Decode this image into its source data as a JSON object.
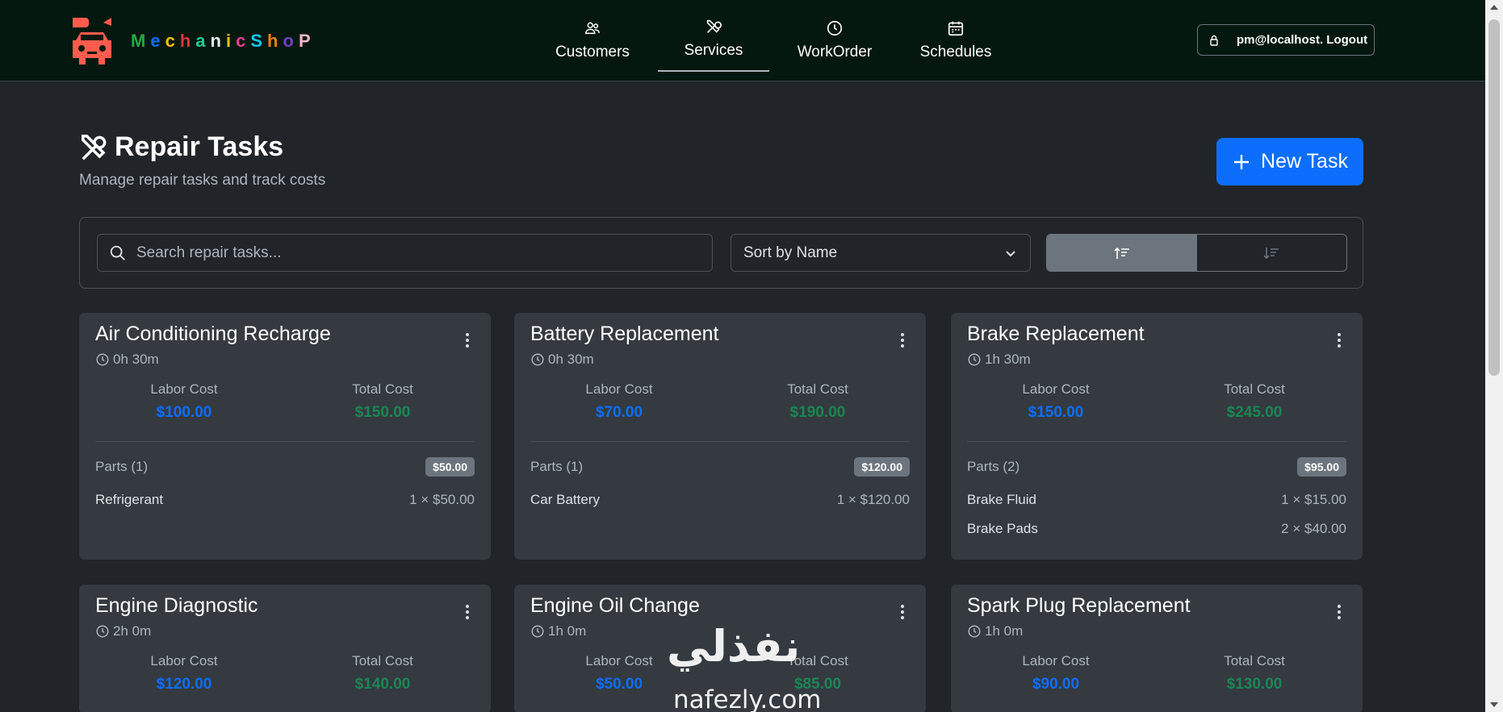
{
  "brand": {
    "letters": [
      "M",
      "e",
      "c",
      "h",
      "a",
      "n",
      "i",
      "c",
      "S",
      "h",
      "o",
      "P"
    ],
    "letter_colors": [
      "#28a745",
      "#0d6efd",
      "#ffc107",
      "#dc3545",
      "#20c997",
      "#e9ecef",
      "#ffc107",
      "#e83e8c",
      "#0dcaf0",
      "#fd7e14",
      "#6f42c1",
      "#f8b4c8"
    ],
    "logo_color": "#ff5c4d"
  },
  "nav": {
    "items": [
      {
        "label": "Customers",
        "icon": "people-icon"
      },
      {
        "label": "Services",
        "icon": "tools-icon",
        "active": true
      },
      {
        "label": "WorkOrder",
        "icon": "clock-icon"
      },
      {
        "label": "Schedules",
        "icon": "calendar-icon"
      }
    ],
    "logout_label": "pm@localhost. Logout"
  },
  "header": {
    "title": "Repair Tasks",
    "subtitle": "Manage repair tasks and track costs",
    "new_task_label": "New Task"
  },
  "filters": {
    "search_placeholder": "Search repair tasks...",
    "sort_selected": "Sort by Name",
    "order": "ascending"
  },
  "cards": [
    {
      "title": "Air Conditioning Recharge",
      "duration": "0h 30m",
      "labor_label": "Labor Cost",
      "labor": "$100.00",
      "total_label": "Total Cost",
      "total": "$150.00",
      "parts_label": "Parts (1)",
      "parts_total": "$50.00",
      "parts": [
        {
          "name": "Refrigerant",
          "qty": "1 × $50.00"
        }
      ]
    },
    {
      "title": "Battery Replacement",
      "duration": "0h 30m",
      "labor_label": "Labor Cost",
      "labor": "$70.00",
      "total_label": "Total Cost",
      "total": "$190.00",
      "parts_label": "Parts (1)",
      "parts_total": "$120.00",
      "parts": [
        {
          "name": "Car Battery",
          "qty": "1 × $120.00"
        }
      ]
    },
    {
      "title": "Brake Replacement",
      "duration": "1h 30m",
      "labor_label": "Labor Cost",
      "labor": "$150.00",
      "total_label": "Total Cost",
      "total": "$245.00",
      "parts_label": "Parts (2)",
      "parts_total": "$95.00",
      "parts": [
        {
          "name": "Brake Fluid",
          "qty": "1 × $15.00"
        },
        {
          "name": "Brake Pads",
          "qty": "2 × $40.00"
        }
      ]
    },
    {
      "title": "Engine Diagnostic",
      "duration": "2h 0m",
      "labor_label": "Labor Cost",
      "labor": "$120.00",
      "total_label": "Total Cost",
      "total": "$140.00"
    },
    {
      "title": "Engine Oil Change",
      "duration": "1h 0m",
      "labor_label": "Labor Cost",
      "labor": "$50.00",
      "total_label": "Total Cost",
      "total": "$85.00"
    },
    {
      "title": "Spark Plug Replacement",
      "duration": "1h 0m",
      "labor_label": "Labor Cost",
      "labor": "$90.00",
      "total_label": "Total Cost",
      "total": "$130.00"
    }
  ],
  "watermark": {
    "arabic": "نفذلي",
    "latin": "nafezly.com"
  }
}
